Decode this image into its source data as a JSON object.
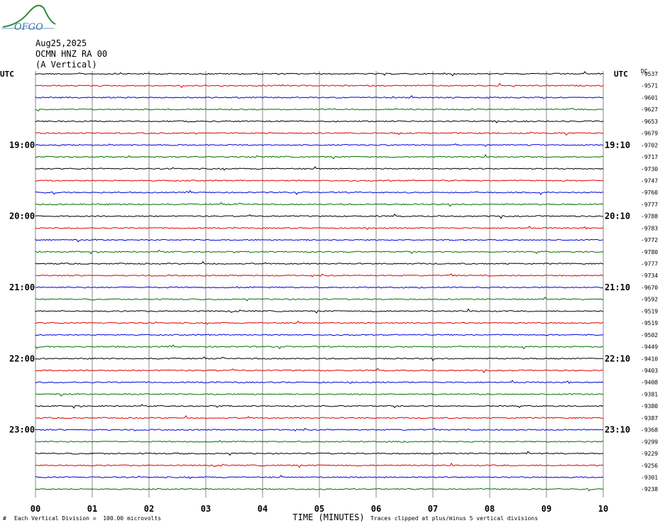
{
  "header": {
    "logo_text": "OFGO",
    "date": "Aug25,2025",
    "station": "OCMN HNZ RA 00",
    "component": "(A Vertical)"
  },
  "chart_data": {
    "type": "line",
    "title": "",
    "left_axis_label": "UTC",
    "right_axis_label": "UTC",
    "dc_label": "DC",
    "xlabel": "TIME (MINUTES)",
    "x_ticks": [
      "00",
      "01",
      "02",
      "03",
      "04",
      "05",
      "06",
      "07",
      "08",
      "09",
      "10"
    ],
    "xlim": [
      0,
      10
    ],
    "grid": true,
    "left_hour_labels": [
      {
        "row": 6,
        "text": "19:00"
      },
      {
        "row": 12,
        "text": "20:00"
      },
      {
        "row": 18,
        "text": "21:00"
      },
      {
        "row": 24,
        "text": "22:00"
      },
      {
        "row": 30,
        "text": "23:00"
      }
    ],
    "right_hour_labels": [
      {
        "row": 6,
        "text": "19:10"
      },
      {
        "row": 12,
        "text": "20:10"
      },
      {
        "row": 18,
        "text": "21:10"
      },
      {
        "row": 24,
        "text": "22:10"
      },
      {
        "row": 30,
        "text": "23:10"
      }
    ],
    "trace_colors": [
      "#000000",
      "#e00000",
      "#0000e0",
      "#007000"
    ],
    "dc_offsets": [
      -9537,
      -9571,
      -9601,
      -9627,
      -9653,
      -9679,
      -9702,
      -9717,
      -9730,
      -9747,
      -9760,
      -9777,
      -9788,
      -9783,
      -9772,
      -9780,
      -9777,
      -9734,
      -9670,
      -9592,
      -9519,
      -9519,
      -9502,
      -9449,
      -9410,
      -9403,
      -9408,
      -9381,
      -9380,
      -9387,
      -9368,
      -9299,
      -9229,
      -9256,
      -9301,
      -9238
    ],
    "scale_note": "Each Vertical Division =  100.00 microvolts",
    "clip_note": "Traces clipped at plus/minus 5 vertical divisions"
  }
}
